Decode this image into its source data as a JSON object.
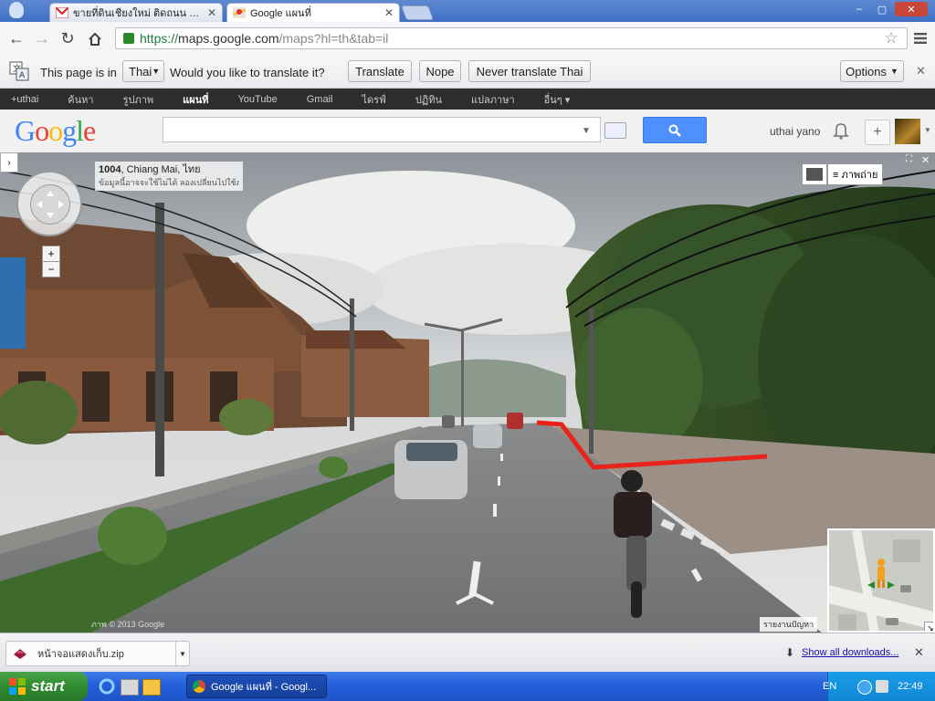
{
  "browser": {
    "tabs": [
      {
        "title": "ขายที่ดินเชียงใหม่ ติดถนน ใกล้เมือง ราคาถูก",
        "favicon": "gmail-icon",
        "active": false
      },
      {
        "title": "Google แผนที่",
        "favicon": "google-maps-icon",
        "active": true
      }
    ],
    "address": {
      "scheme": "https://",
      "host": "maps.google.com",
      "path": "/maps?hl=th&tab=il"
    },
    "window_controls": [
      "–",
      "▢",
      "✕"
    ]
  },
  "translate_bar": {
    "message_before": "This page is in",
    "language": "Thai",
    "question": "Would you like to translate it?",
    "translate_label": "Translate",
    "nope_label": "Nope",
    "never_label": "Never translate Thai",
    "options_label": "Options"
  },
  "google_bar": {
    "items": [
      "+uthai",
      "ค้นหา",
      "รูปภาพ",
      "แผนที่",
      "YouTube",
      "Gmail",
      "ไดรฟ์",
      "ปฏิทิน",
      "แปลภาษา",
      "อื่นๆ ▾"
    ],
    "active": "แผนที่"
  },
  "maps_header": {
    "logo": "Google",
    "search_placeholder": "",
    "user_name": "uthai yano"
  },
  "streetview": {
    "address_line1_bold": "1004",
    "address_line1_rest": ", Chiang Mai, ไทย",
    "address_line2": "ข้อมูลนี้อาจจะใช้ไม่ได้ ลองเปลี่ยนไปใช้ภาพอื่น",
    "view_button_label": "≡ ภาพถ่าย",
    "copyright": "ภาพ © 2013 Google",
    "report_label": "รายงานปัญหา"
  },
  "download_bar": {
    "file_name": "หน้าจอแสดงเก็บ.zip",
    "show_all": "Show all downloads...",
    "close": "✕"
  },
  "taskbar": {
    "start_label": "start",
    "task_label": "Google แผนที่ - Googl...",
    "language": "EN",
    "clock": "22:49"
  },
  "colors": {
    "route_line": "#e8231c",
    "maps_search_blue": "#4d90fe",
    "taskbar_blue": "#245edb",
    "start_green": "#2f8a2f"
  }
}
